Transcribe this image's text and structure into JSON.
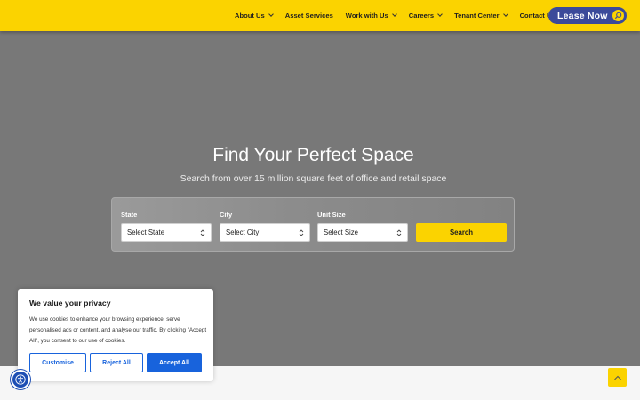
{
  "header": {
    "nav": [
      {
        "label": "About Us",
        "has_dropdown": true
      },
      {
        "label": "Asset Services",
        "has_dropdown": false
      },
      {
        "label": "Work with Us",
        "has_dropdown": true
      },
      {
        "label": "Careers",
        "has_dropdown": true
      },
      {
        "label": "Tenant Center",
        "has_dropdown": true
      },
      {
        "label": "Contact Us",
        "has_dropdown": false
      }
    ],
    "lease_button": "Lease Now"
  },
  "hero": {
    "title": "Find Your Perfect Space",
    "subtitle": "Search from over 15 million square feet of office and retail space"
  },
  "search": {
    "state_label": "State",
    "state_value": "Select State",
    "city_label": "City",
    "city_value": "Select City",
    "size_label": "Unit Size",
    "size_value": "Select Size",
    "button": "Search"
  },
  "cookie": {
    "title": "We value your privacy",
    "text": "We use cookies to enhance your browsing experience, serve personalised ads or content, and analyse our traffic. By clicking \"Accept All\", you consent to our use of cookies.",
    "customise": "Customise",
    "reject": "Reject All",
    "accept": "Accept All"
  },
  "colors": {
    "brand_yellow": "#fbd300",
    "lease_blue": "#3b4a9a",
    "cookie_blue": "#1863dc",
    "hero_gray": "#787878"
  },
  "icons": {
    "lease": "search-icon",
    "accessibility": "accessibility-icon",
    "scroll_top": "chevron-up-icon"
  }
}
